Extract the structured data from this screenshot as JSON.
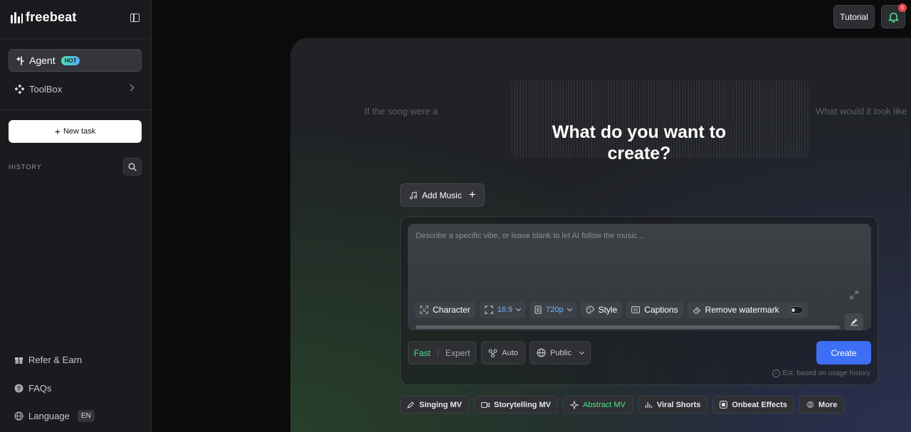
{
  "app": {
    "name": "freebeat"
  },
  "sidebar": {
    "agent_label": "Agent",
    "hot_badge": "HOT",
    "toolbox_label": "ToolBox",
    "new_task_label": "New task",
    "history_label": "HISTORY",
    "refer_label": "Refer & Earn",
    "faqs_label": "FAQs",
    "language_label": "Language",
    "language_code": "EN"
  },
  "header": {
    "tutorial_label": "Tutorial",
    "notification_count": "6"
  },
  "main": {
    "ghost_left": "If the song were a",
    "ghost_right": "What would it look like",
    "headline_line1": "What do you want to",
    "headline_line2": "create?",
    "add_music_label": "Add Music",
    "prompt_placeholder": "Describe a specific vibe, or leave blank to let AI follow the music...",
    "options": {
      "character": "Character",
      "ratio": "16:9",
      "resolution": "720p",
      "style": "Style",
      "captions": "Captions",
      "remove_watermark": "Remove watermark"
    },
    "mode_fast": "Fast",
    "mode_expert": "Expert",
    "auto_label": "Auto",
    "visibility_label": "Public",
    "create_label": "Create",
    "estimate_note": "Est. based on usage history"
  },
  "quick_actions": [
    {
      "label": "Singing MV",
      "icon": "pen-icon"
    },
    {
      "label": "Storytelling MV",
      "icon": "video-icon"
    },
    {
      "label": "Abstract MV",
      "icon": "sparkle-icon"
    },
    {
      "label": "Viral Shorts",
      "icon": "bars-icon"
    },
    {
      "label": "Onbeat Effects",
      "icon": "effects-icon"
    },
    {
      "label": "More",
      "icon": "dots-icon"
    }
  ],
  "colors": {
    "accent_green": "#4ee28a",
    "accent_blue": "#3d6ff5",
    "value_blue": "#6fb8ff",
    "notification_red": "#e54545"
  }
}
